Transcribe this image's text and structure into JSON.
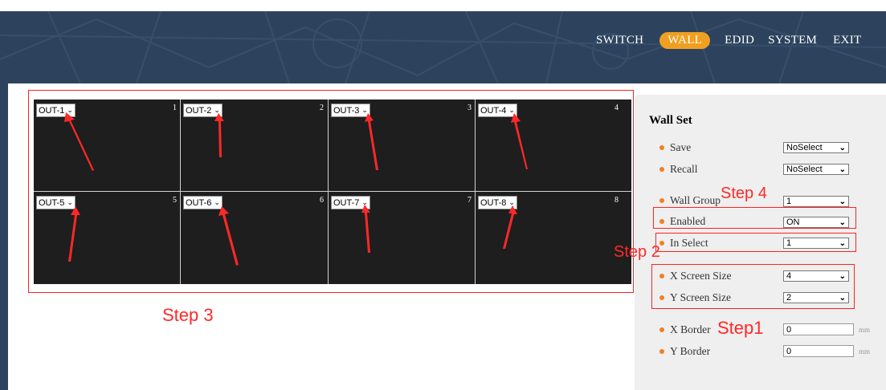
{
  "nav": {
    "items": [
      {
        "label": "SWITCH",
        "active": false
      },
      {
        "label": "WALL",
        "active": true
      },
      {
        "label": "EDID",
        "active": false
      },
      {
        "label": "SYSTEM",
        "active": false
      },
      {
        "label": "EXIT",
        "active": false
      }
    ],
    "accent_color": "#f0a020",
    "bar_color": "#2d435d"
  },
  "wall_grid": {
    "cells": [
      {
        "output": "OUT-1",
        "number": "1"
      },
      {
        "output": "OUT-2",
        "number": "2"
      },
      {
        "output": "OUT-3",
        "number": "3"
      },
      {
        "output": "OUT-4",
        "number": "4"
      },
      {
        "output": "OUT-5",
        "number": "5"
      },
      {
        "output": "OUT-6",
        "number": "6"
      },
      {
        "output": "OUT-7",
        "number": "7"
      },
      {
        "output": "OUT-8",
        "number": "8"
      }
    ]
  },
  "panel": {
    "title": "Wall Set",
    "rows": {
      "save": {
        "label": "Save",
        "value": "NoSelect"
      },
      "recall": {
        "label": "Recall",
        "value": "NoSelect"
      },
      "wall_group": {
        "label": "Wall Group",
        "value": "1"
      },
      "enabled": {
        "label": "Enabled",
        "value": "ON"
      },
      "in_select": {
        "label": "In Select",
        "value": "1"
      },
      "x_screen_size": {
        "label": "X Screen Size",
        "value": "4"
      },
      "y_screen_size": {
        "label": "Y Screen Size",
        "value": "2"
      },
      "x_border": {
        "label": "X Border",
        "value": "0",
        "unit": "mm"
      },
      "y_border": {
        "label": "Y Border",
        "value": "0",
        "unit": "mm"
      }
    }
  },
  "annotations": {
    "step1": "Step1",
    "step2": "Step 2",
    "step3": "Step 3",
    "step4": "Step 4",
    "color": "#ff2828"
  }
}
